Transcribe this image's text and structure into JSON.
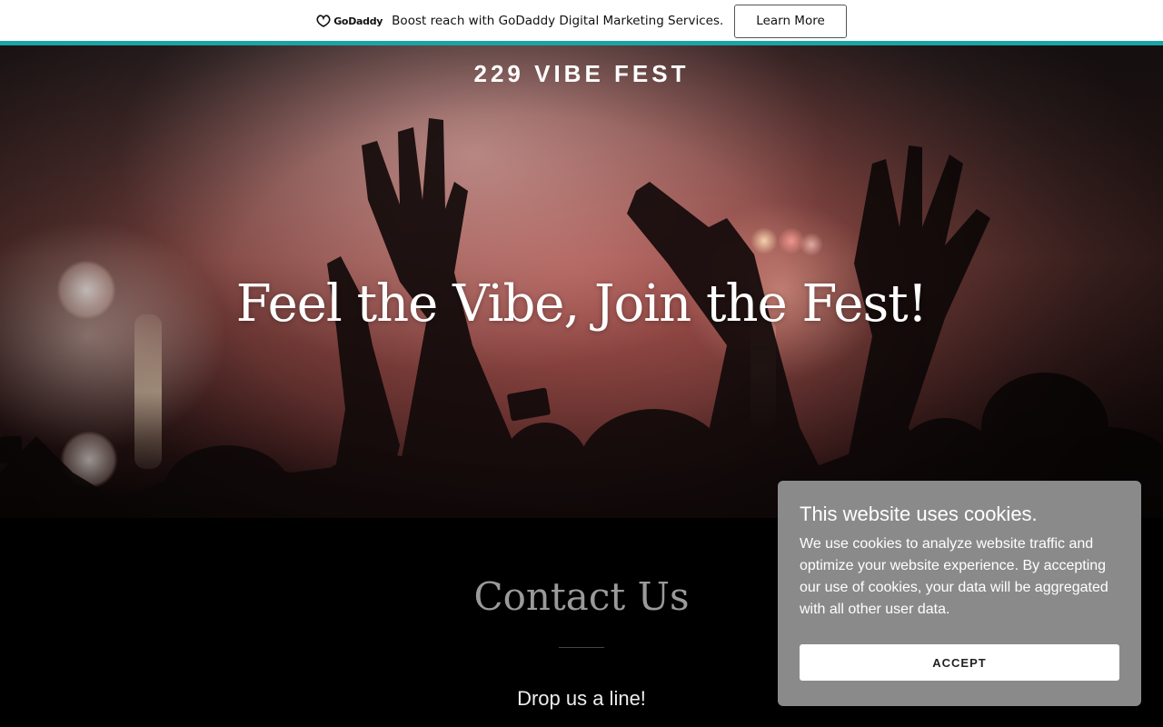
{
  "promo": {
    "logo_text": "GoDaddy",
    "message": "Boost reach with GoDaddy Digital Marketing Services.",
    "button_label": "Learn More",
    "accent_color": "#1ba4a4"
  },
  "hero": {
    "site_title": "229 VIBE FEST",
    "heading": "Feel the Vibe, Join the Fest!"
  },
  "contact": {
    "title": "Contact Us",
    "subtitle": "Drop us a line!"
  },
  "cookie_banner": {
    "title": "This website uses cookies.",
    "body": "We use cookies to analyze website traffic and optimize your website experience. By accepting our use of cookies, your data will be aggregated with all other user data.",
    "accept_label": "ACCEPT",
    "background_color": "#8a8a8a"
  }
}
